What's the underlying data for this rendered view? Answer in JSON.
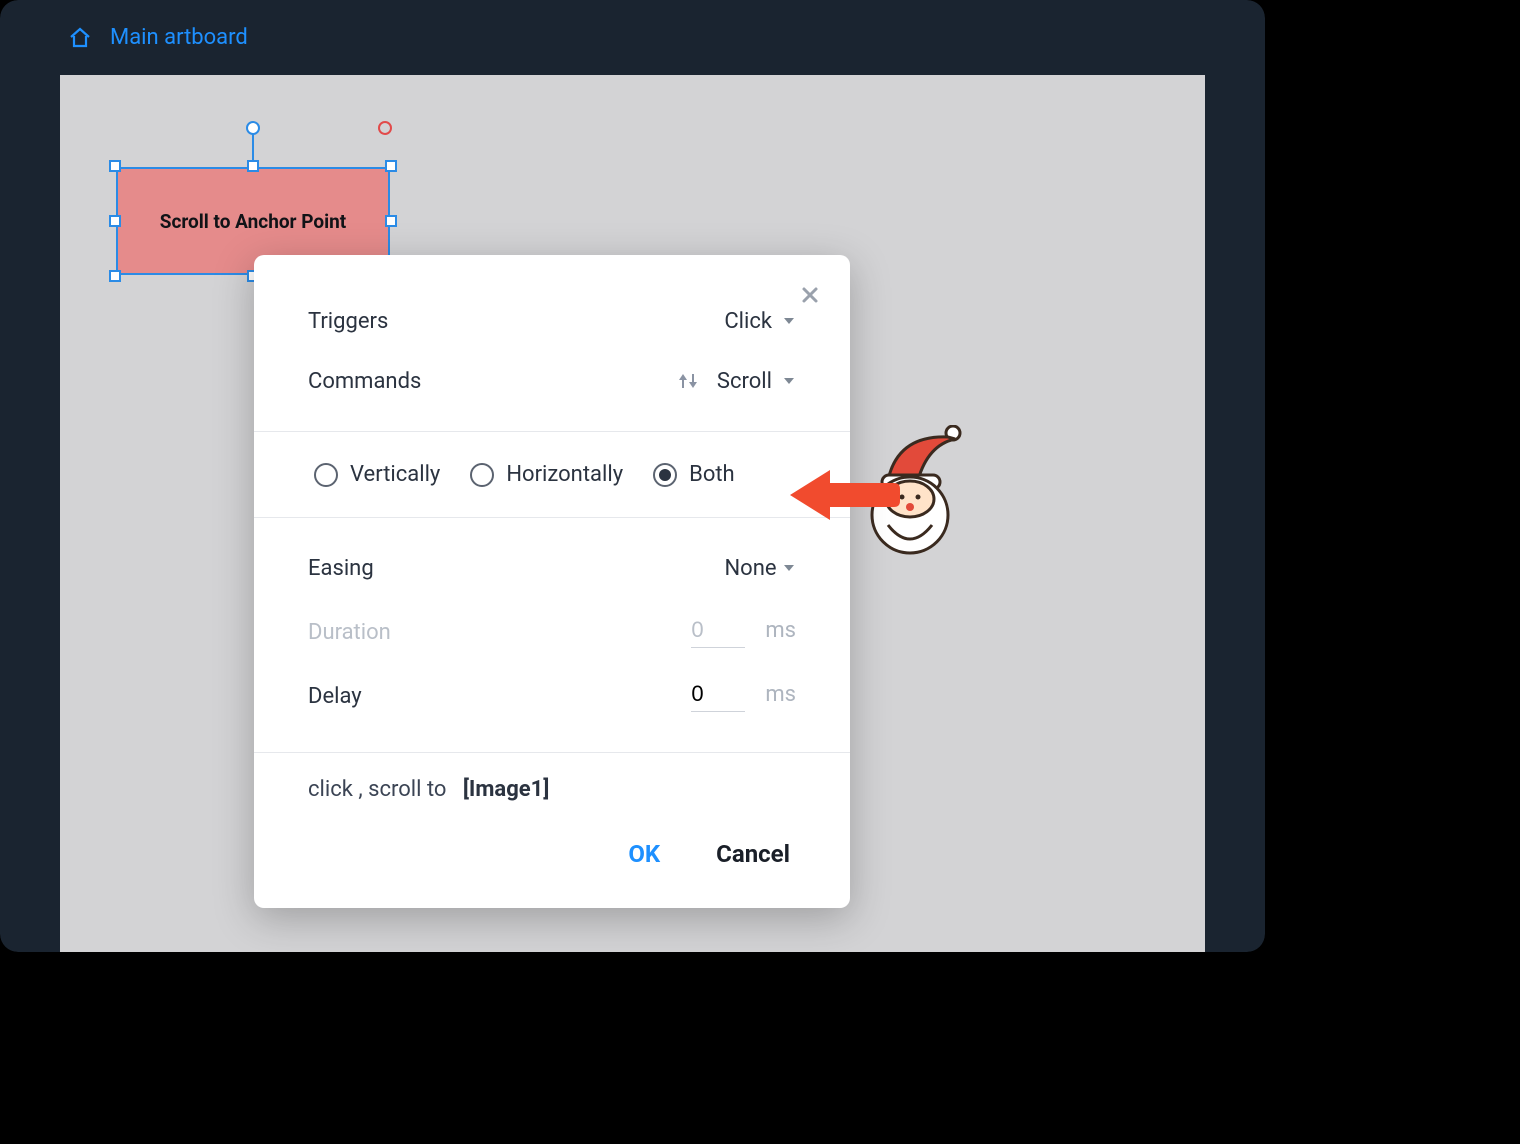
{
  "breadcrumb": {
    "label": "Main artboard"
  },
  "selected_element": {
    "label": "Scroll to Anchor Point"
  },
  "dialog": {
    "triggers": {
      "label": "Triggers",
      "value": "Click"
    },
    "commands": {
      "label": "Commands",
      "value": "Scroll"
    },
    "direction": {
      "options": [
        "Vertically",
        "Horizontally",
        "Both"
      ],
      "selected": "Both"
    },
    "easing": {
      "label": "Easing",
      "value": "None"
    },
    "duration": {
      "label": "Duration",
      "value": "0",
      "unit": "ms",
      "disabled": true
    },
    "delay": {
      "label": "Delay",
      "value": "0",
      "unit": "ms"
    },
    "summary": {
      "prefix": "click , scroll to",
      "target": "[Image1]"
    },
    "ok_label": "OK",
    "cancel_label": "Cancel"
  }
}
